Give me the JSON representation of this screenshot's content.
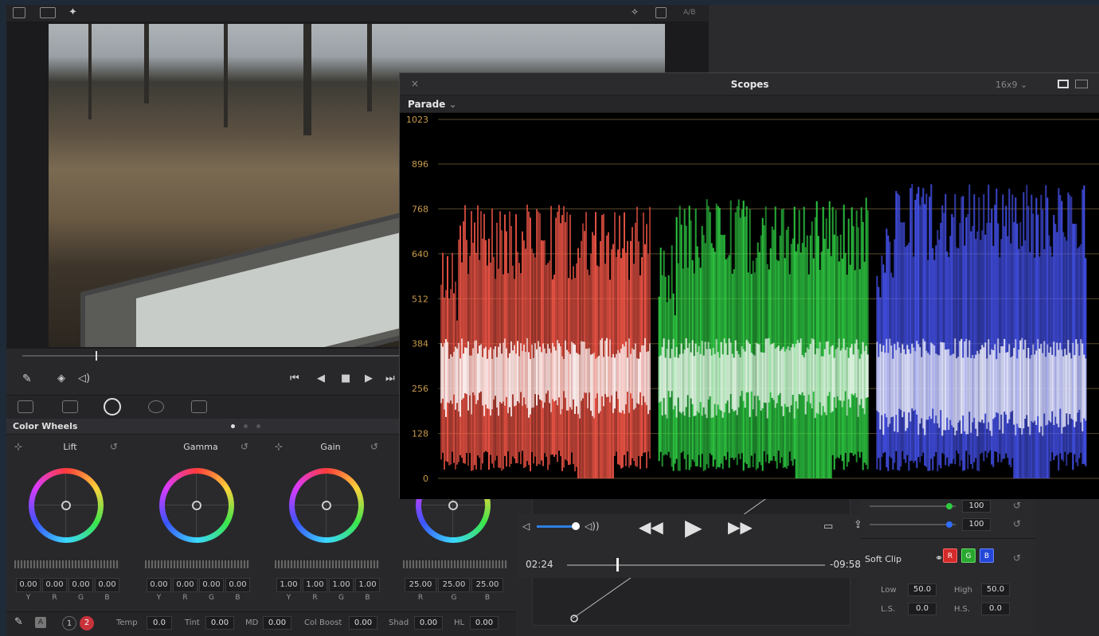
{
  "topbar": {
    "ab_label": "A/B"
  },
  "viewer": {},
  "color_wheels": {
    "title": "Color Wheels",
    "wheels": [
      {
        "label": "Lift",
        "values": [
          "0.00",
          "0.00",
          "0.00",
          "0.00"
        ],
        "channels": [
          "Y",
          "R",
          "G",
          "B"
        ]
      },
      {
        "label": "Gamma",
        "values": [
          "0.00",
          "0.00",
          "0.00",
          "0.00"
        ],
        "channels": [
          "Y",
          "R",
          "G",
          "B"
        ]
      },
      {
        "label": "Gain",
        "values": [
          "1.00",
          "1.00",
          "1.00",
          "1.00"
        ],
        "channels": [
          "Y",
          "R",
          "G",
          "B"
        ]
      },
      {
        "label": "",
        "values": [
          "25.00",
          "25.00",
          "25.00"
        ],
        "channels": [
          "R",
          "G",
          "B"
        ]
      }
    ]
  },
  "bottom_bar": {
    "page1": "1",
    "page2": "2",
    "temp_label": "Temp",
    "temp_value": "0.0",
    "tint_label": "Tint",
    "tint_value": "0.00",
    "md_label": "MD",
    "md_value": "0.00",
    "colboost_label": "Col Boost",
    "colboost_value": "0.00",
    "shad_label": "Shad",
    "shad_value": "0.00",
    "hl_label": "HL",
    "hl_value": "0.00"
  },
  "media_player": {
    "current_time": "02:24",
    "remaining_time": "-09:58"
  },
  "rgb_panel": {
    "green_value": "100",
    "blue_value": "100",
    "soft_clip_label": "Soft Clip",
    "chip_r": "R",
    "chip_g": "G",
    "chip_b": "B",
    "low_label": "Low",
    "low_value": "50.0",
    "high_label": "High",
    "high_value": "50.0",
    "ls_label": "L.S.",
    "ls_value": "0.0",
    "hs_label": "H.S.",
    "hs_value": "0.0"
  },
  "scopes": {
    "title": "Scopes",
    "ratio": "16x9",
    "mode": "Parade",
    "close_glyph": "×"
  },
  "chart_data": {
    "type": "area",
    "title": "Parade",
    "y_ticks": [
      1023,
      896,
      768,
      640,
      512,
      384,
      256,
      128,
      0
    ],
    "ylim": [
      0,
      1023
    ],
    "grid": true,
    "series": [
      {
        "name": "R",
        "color": "#ff5a4a",
        "peak": 780,
        "dense_low": 250,
        "dense_high": 400
      },
      {
        "name": "G",
        "color": "#33e04a",
        "peak": 800,
        "dense_low": 250,
        "dense_high": 400
      },
      {
        "name": "B",
        "color": "#4a58ff",
        "peak": 840,
        "dense_low": 200,
        "dense_high": 400
      }
    ]
  }
}
